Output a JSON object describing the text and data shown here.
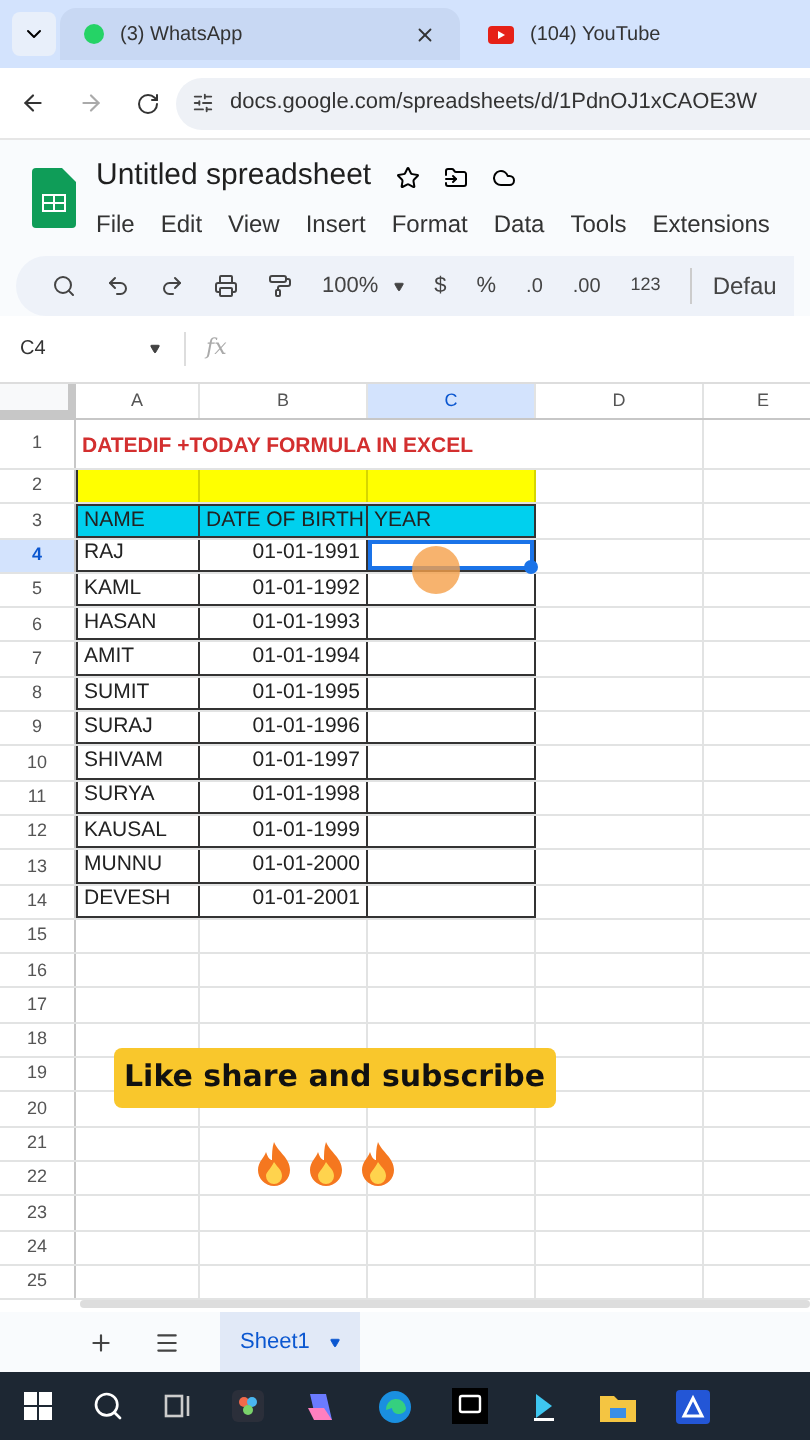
{
  "browser": {
    "tabs": [
      {
        "title": "(3) WhatsApp",
        "kind": "whatsapp",
        "selected": true
      },
      {
        "title": "(104) YouTube",
        "kind": "youtube",
        "selected": false
      }
    ],
    "url": "docs.google.com/spreadsheets/d/1PdnOJ1xCAOE3W"
  },
  "doc": {
    "title": "Untitled spreadsheet",
    "menu": [
      "File",
      "Edit",
      "View",
      "Insert",
      "Format",
      "Data",
      "Tools",
      "Extensions"
    ]
  },
  "toolbar": {
    "zoom": "100%",
    "currency": "$",
    "percent": "%",
    "decrease_decimal": ".0",
    "increase_decimal": ".00",
    "number_format": "123",
    "font": "Defau"
  },
  "formula_bar": {
    "cell": "C4",
    "fx": "fx"
  },
  "columns": [
    {
      "label": "A",
      "selected": false
    },
    {
      "label": "B",
      "selected": false
    },
    {
      "label": "C",
      "selected": true
    },
    {
      "label": "D",
      "selected": false
    },
    {
      "label": "E",
      "selected": false
    }
  ],
  "rows": [
    {
      "number": "1",
      "selected": false,
      "kind": "title",
      "cells": [
        "DATEDIF +TODAY FORMULA IN EXCEL"
      ]
    },
    {
      "number": "2",
      "selected": false,
      "kind": "band",
      "cells": []
    },
    {
      "number": "3",
      "selected": false,
      "kind": "header",
      "cells": [
        "NAME",
        "DATE OF BIRTH",
        "YEAR"
      ]
    },
    {
      "number": "4",
      "selected": true,
      "kind": "data",
      "cells": [
        "RAJ",
        "01-01-1991"
      ]
    },
    {
      "number": "5",
      "selected": false,
      "kind": "data",
      "cells": [
        "KAML",
        "01-01-1992"
      ]
    },
    {
      "number": "6",
      "selected": false,
      "kind": "data",
      "cells": [
        "HASAN",
        "01-01-1993"
      ]
    },
    {
      "number": "7",
      "selected": false,
      "kind": "data",
      "cells": [
        "AMIT",
        "01-01-1994"
      ]
    },
    {
      "number": "8",
      "selected": false,
      "kind": "data",
      "cells": [
        "SUMIT",
        "01-01-1995"
      ]
    },
    {
      "number": "9",
      "selected": false,
      "kind": "data",
      "cells": [
        "SURAJ",
        "01-01-1996"
      ]
    },
    {
      "number": "10",
      "selected": false,
      "kind": "data",
      "cells": [
        "SHIVAM",
        "01-01-1997"
      ]
    },
    {
      "number": "11",
      "selected": false,
      "kind": "data",
      "cells": [
        "SURYA",
        "01-01-1998"
      ]
    },
    {
      "number": "12",
      "selected": false,
      "kind": "data",
      "cells": [
        "KAUSAL",
        "01-01-1999"
      ]
    },
    {
      "number": "13",
      "selected": false,
      "kind": "data",
      "cells": [
        "MUNNU",
        "01-01-2000"
      ]
    },
    {
      "number": "14",
      "selected": false,
      "kind": "data",
      "cells": [
        "DEVESH",
        "01-01-2001"
      ]
    },
    {
      "number": "15",
      "selected": false,
      "kind": "empty",
      "cells": []
    },
    {
      "number": "16",
      "selected": false,
      "kind": "empty",
      "cells": []
    },
    {
      "number": "17",
      "selected": false,
      "kind": "empty",
      "cells": []
    },
    {
      "number": "18",
      "selected": false,
      "kind": "empty",
      "cells": []
    },
    {
      "number": "19",
      "selected": false,
      "kind": "empty",
      "cells": []
    },
    {
      "number": "20",
      "selected": false,
      "kind": "empty",
      "cells": []
    },
    {
      "number": "21",
      "selected": false,
      "kind": "empty",
      "cells": []
    },
    {
      "number": "22",
      "selected": false,
      "kind": "empty",
      "cells": []
    },
    {
      "number": "23",
      "selected": false,
      "kind": "empty",
      "cells": []
    },
    {
      "number": "24",
      "selected": false,
      "kind": "empty",
      "cells": []
    },
    {
      "number": "25",
      "selected": false,
      "kind": "empty",
      "cells": []
    }
  ],
  "caption": "Like share and subscribe",
  "sheets": [
    {
      "label": "Sheet1",
      "selected": true
    }
  ]
}
